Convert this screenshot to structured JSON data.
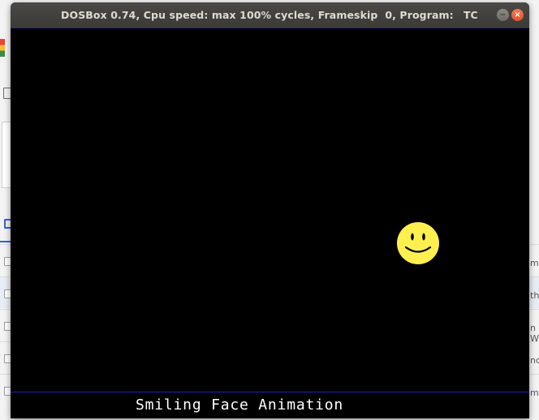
{
  "window": {
    "title": "DOSBox 0.74, Cpu speed: max 100% cycles, Frameskip  0, Program:",
    "program_name": "TC",
    "minimize_icon": "minimize-icon",
    "close_icon": "close-icon",
    "minimize_glyph": "−",
    "close_glyph": "×"
  },
  "screen": {
    "caption": "Smiling Face Animation",
    "face_color": "#fff050",
    "line_color": "#2222b5"
  },
  "background": {
    "right_edge_texts": [
      "m",
      "th",
      "n W",
      "nc",
      "m"
    ]
  }
}
